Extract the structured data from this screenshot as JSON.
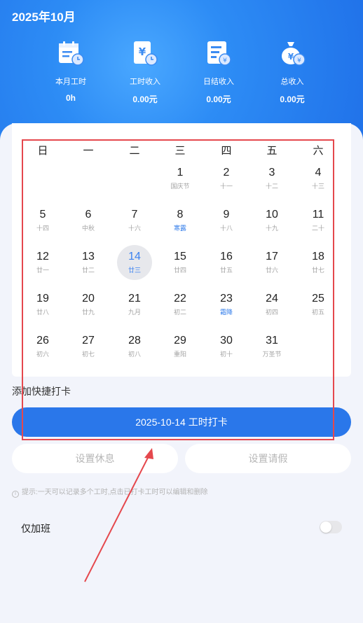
{
  "header": {
    "month_title": "2025年10月",
    "stats": [
      {
        "icon": "calendar-clock-icon",
        "label": "本月工时",
        "value": "0h"
      },
      {
        "icon": "hourly-income-icon",
        "label": "工时收入",
        "value": "0.00元"
      },
      {
        "icon": "daily-settlement-icon",
        "label": "日结收入",
        "value": "0.00元"
      },
      {
        "icon": "money-bag-icon",
        "label": "总收入",
        "value": "0.00元"
      }
    ]
  },
  "calendar": {
    "weekdays": [
      "日",
      "一",
      "二",
      "三",
      "四",
      "五",
      "六"
    ],
    "weeks": [
      [
        null,
        null,
        null,
        {
          "num": "1",
          "lunar": "国庆节"
        },
        {
          "num": "2",
          "lunar": "十一"
        },
        {
          "num": "3",
          "lunar": "十二"
        },
        {
          "num": "4",
          "lunar": "十三"
        }
      ],
      [
        {
          "num": "5",
          "lunar": "十四"
        },
        {
          "num": "6",
          "lunar": "中秋"
        },
        {
          "num": "7",
          "lunar": "十六"
        },
        {
          "num": "8",
          "lunar": "寒露",
          "term": true
        },
        {
          "num": "9",
          "lunar": "十八"
        },
        {
          "num": "10",
          "lunar": "十九"
        },
        {
          "num": "11",
          "lunar": "二十"
        }
      ],
      [
        {
          "num": "12",
          "lunar": "廿一"
        },
        {
          "num": "13",
          "lunar": "廿二"
        },
        {
          "num": "14",
          "lunar": "廿三",
          "selected": true
        },
        {
          "num": "15",
          "lunar": "廿四"
        },
        {
          "num": "16",
          "lunar": "廿五"
        },
        {
          "num": "17",
          "lunar": "廿六"
        },
        {
          "num": "18",
          "lunar": "廿七"
        }
      ],
      [
        {
          "num": "19",
          "lunar": "廿八"
        },
        {
          "num": "20",
          "lunar": "廿九"
        },
        {
          "num": "21",
          "lunar": "九月"
        },
        {
          "num": "22",
          "lunar": "初二"
        },
        {
          "num": "23",
          "lunar": "霜降",
          "term": true
        },
        {
          "num": "24",
          "lunar": "初四"
        },
        {
          "num": "25",
          "lunar": "初五"
        }
      ],
      [
        {
          "num": "26",
          "lunar": "初六"
        },
        {
          "num": "27",
          "lunar": "初七"
        },
        {
          "num": "28",
          "lunar": "初八"
        },
        {
          "num": "29",
          "lunar": "重阳"
        },
        {
          "num": "30",
          "lunar": "初十"
        },
        {
          "num": "31",
          "lunar": "万圣节"
        },
        null
      ]
    ]
  },
  "quick": {
    "label": "添加快捷打卡",
    "punch_button": "2025-10-14 工时打卡",
    "rest_button": "设置休息",
    "leave_button": "设置请假",
    "tip": "提示:一天可以记录多个工时,点击已打卡工时可以编辑和删除"
  },
  "overtime": {
    "label": "仅加班",
    "enabled": false
  },
  "colors": {
    "header_blue": "#2d8cf5",
    "accent_blue": "#2a77ea",
    "solar_term": "#2f7bea",
    "annotation_red": "#e5484d"
  }
}
